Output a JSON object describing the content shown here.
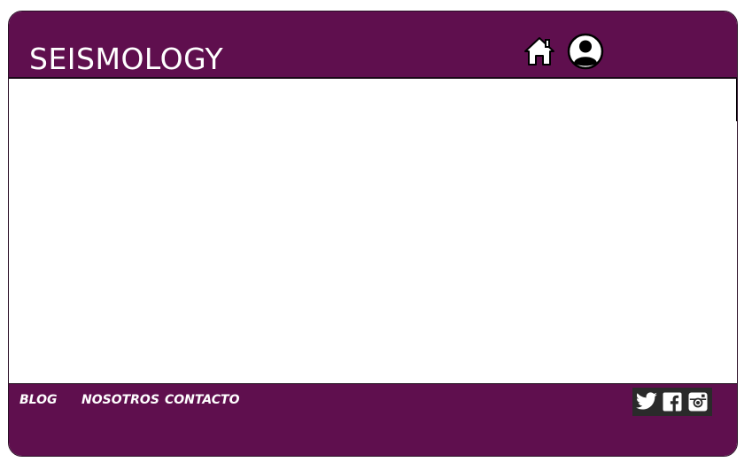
{
  "header": {
    "title": "SEISMOLOGY",
    "icons": {
      "home": "home-icon",
      "user": "user-account-icon"
    }
  },
  "footer": {
    "links": [
      {
        "label": "BLOG"
      },
      {
        "label": "NOSOTROS"
      },
      {
        "label": "CONTACTO"
      }
    ],
    "social": [
      {
        "icon": "twitter-icon"
      },
      {
        "icon": "facebook-icon"
      },
      {
        "icon": "instagram-icon"
      }
    ]
  },
  "colors": {
    "brand_purple": "#5f0f4e",
    "text_white": "#ffffff",
    "social_bar": "#2a2a2a"
  }
}
